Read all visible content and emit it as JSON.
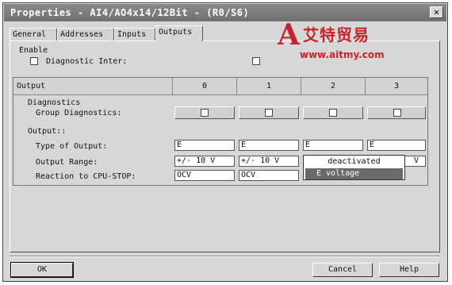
{
  "window": {
    "title": "Properties - AI4/AO4x14/12Bit - (R0/S6)",
    "close_glyph": "✕"
  },
  "tabs": [
    {
      "label": "General"
    },
    {
      "label": "Addresses"
    },
    {
      "label": "Inputs"
    },
    {
      "label": "Outputs",
      "active": true
    }
  ],
  "watermark": {
    "mark": "A",
    "name": "艾特贸易",
    "url": "www.aitmy.com"
  },
  "enable": {
    "group_label": "Enable",
    "diagnostic_interrupt_label": "Diagnostic Inter:"
  },
  "table": {
    "header_label": "Output",
    "channels": [
      "0",
      "1",
      "2",
      "3"
    ],
    "diagnostics_label": "Diagnostics",
    "group_diagnostics_label": "Group Diagnostics:",
    "output_section_label": "Output::",
    "type_of_output_label": "Type of Output:",
    "output_range_label": "Output Range:",
    "reaction_label": "Reaction to CPU-STOP:",
    "type_values": [
      "E",
      "E",
      "E",
      "E"
    ],
    "range_values": [
      "+/- 10 V",
      "+/- 10 V",
      "",
      "V"
    ],
    "reaction_values": [
      "OCV",
      "OCV"
    ]
  },
  "dropdown": {
    "options": [
      "deactivated",
      "E voltage"
    ],
    "selected": "E voltage"
  },
  "buttons": {
    "ok": "OK",
    "cancel": "Cancel",
    "help": "Help"
  }
}
